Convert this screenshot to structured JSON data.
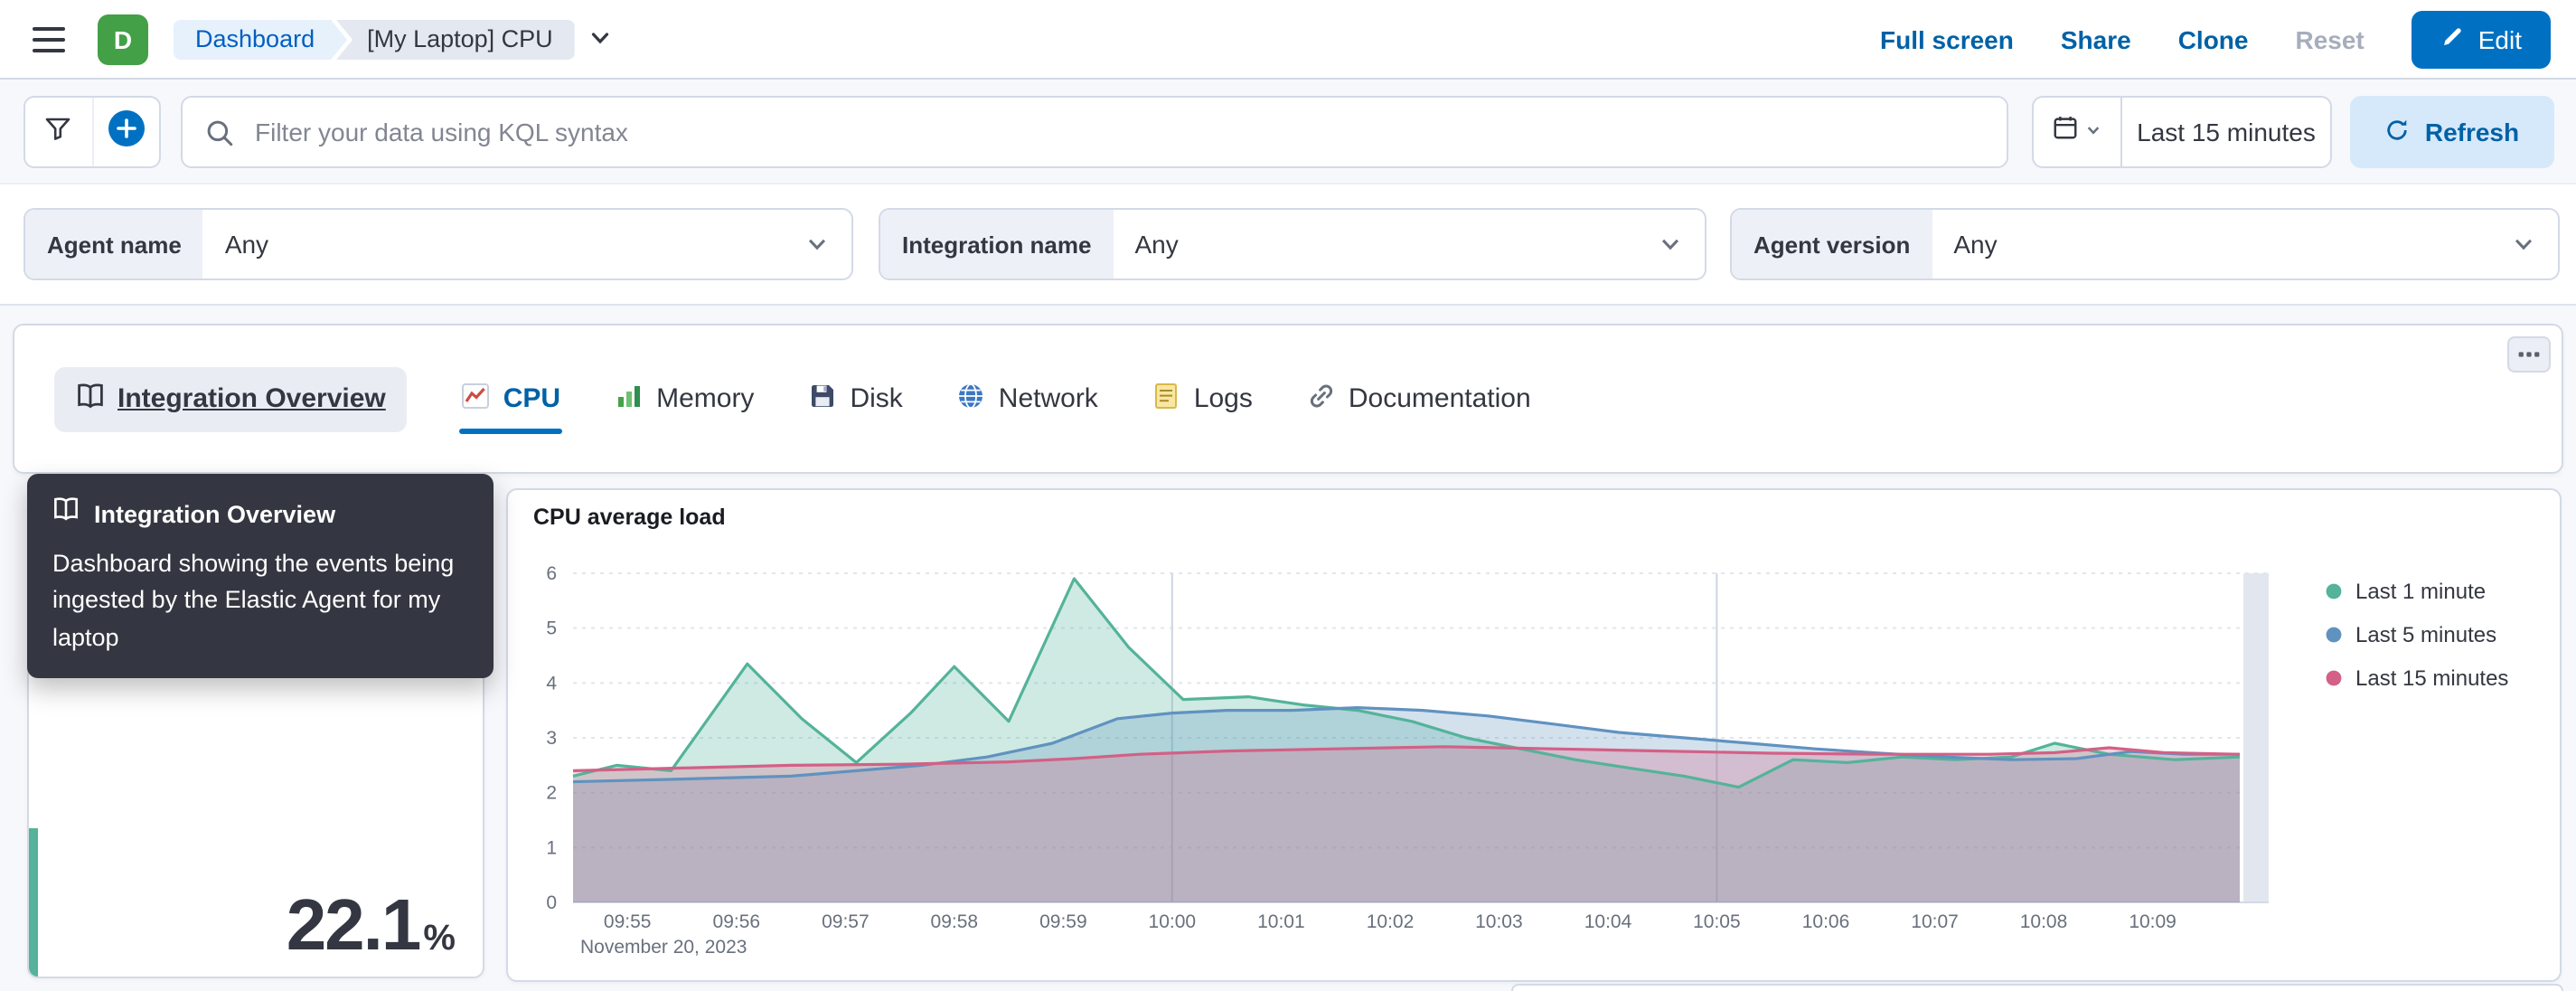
{
  "header": {
    "space_initial": "D",
    "space_color": "#43A047",
    "breadcrumbs": [
      {
        "label": "Dashboard"
      },
      {
        "label": "[My Laptop] CPU"
      }
    ],
    "actions": {
      "full_screen": "Full screen",
      "share": "Share",
      "clone": "Clone",
      "reset": "Reset",
      "edit": "Edit"
    }
  },
  "query_bar": {
    "search_placeholder": "Filter your data using KQL syntax",
    "time_range": "Last 15 minutes",
    "refresh_label": "Refresh"
  },
  "controls": [
    {
      "label": "Agent name",
      "value": "Any"
    },
    {
      "label": "Integration name",
      "value": "Any"
    },
    {
      "label": "Agent version",
      "value": "Any"
    }
  ],
  "links_panel": {
    "tabs": [
      {
        "label": "Integration Overview",
        "icon": "book-icon",
        "state": "hovered"
      },
      {
        "label": "CPU",
        "icon": "line-chart-icon",
        "state": "selected"
      },
      {
        "label": "Memory",
        "icon": "bar-chart-icon",
        "state": "default"
      },
      {
        "label": "Disk",
        "icon": "floppy-disk-icon",
        "state": "default"
      },
      {
        "label": "Network",
        "icon": "globe-icon",
        "state": "default"
      },
      {
        "label": "Logs",
        "icon": "notepad-icon",
        "state": "default"
      },
      {
        "label": "Documentation",
        "icon": "link-icon",
        "state": "default"
      }
    ]
  },
  "tooltip": {
    "title": "Integration Overview",
    "body": "Dashboard showing the events being ingested by the Elastic Agent for my laptop"
  },
  "metric_panel": {
    "value": "22.1",
    "unit": "%",
    "accent_color": "#54B399"
  },
  "chart_data": {
    "type": "area",
    "title": "CPU average load",
    "x_date_label": "November 20, 2023",
    "x_origin_time": "09:54:30",
    "x_points_unit": "minutes after x_origin_time",
    "x_ticks": [
      "09:55",
      "09:56",
      "09:57",
      "09:58",
      "09:59",
      "10:00",
      "10:01",
      "10:02",
      "10:03",
      "10:04",
      "10:05",
      "10:06",
      "10:07",
      "10:08",
      "10:09"
    ],
    "highlight_ticks": [
      "10:00",
      "10:05"
    ],
    "y_ticks": [
      0,
      1,
      2,
      3,
      4,
      5,
      6
    ],
    "ylim": [
      0,
      6
    ],
    "legend_position": "right",
    "series": [
      {
        "name": "Last 1 minute",
        "color": "#54B399",
        "points": [
          [
            0,
            2.3
          ],
          [
            0.4,
            2.5
          ],
          [
            0.9,
            2.4
          ],
          [
            1.6,
            4.35
          ],
          [
            2.1,
            3.35
          ],
          [
            2.6,
            2.55
          ],
          [
            3.1,
            3.45
          ],
          [
            3.5,
            4.3
          ],
          [
            4.0,
            3.3
          ],
          [
            4.6,
            5.9
          ],
          [
            5.1,
            4.65
          ],
          [
            5.6,
            3.7
          ],
          [
            6.2,
            3.75
          ],
          [
            6.7,
            3.6
          ],
          [
            7.2,
            3.5
          ],
          [
            7.7,
            3.3
          ],
          [
            8.2,
            3.0
          ],
          [
            8.7,
            2.8
          ],
          [
            9.2,
            2.6
          ],
          [
            9.7,
            2.45
          ],
          [
            10.2,
            2.3
          ],
          [
            10.7,
            2.1
          ],
          [
            11.2,
            2.6
          ],
          [
            11.7,
            2.55
          ],
          [
            12.2,
            2.65
          ],
          [
            12.7,
            2.6
          ],
          [
            13.2,
            2.65
          ],
          [
            13.6,
            2.9
          ],
          [
            14.1,
            2.7
          ],
          [
            14.7,
            2.6
          ],
          [
            15.3,
            2.65
          ]
        ]
      },
      {
        "name": "Last 5 minutes",
        "color": "#6092C0",
        "points": [
          [
            0,
            2.2
          ],
          [
            1,
            2.25
          ],
          [
            2,
            2.3
          ],
          [
            2.6,
            2.4
          ],
          [
            3.2,
            2.5
          ],
          [
            3.8,
            2.65
          ],
          [
            4.4,
            2.9
          ],
          [
            5.0,
            3.35
          ],
          [
            5.5,
            3.45
          ],
          [
            6.0,
            3.5
          ],
          [
            6.6,
            3.5
          ],
          [
            7.2,
            3.55
          ],
          [
            7.8,
            3.5
          ],
          [
            8.4,
            3.4
          ],
          [
            9.0,
            3.25
          ],
          [
            9.6,
            3.1
          ],
          [
            10.2,
            3.0
          ],
          [
            10.8,
            2.9
          ],
          [
            11.4,
            2.8
          ],
          [
            12.0,
            2.72
          ],
          [
            12.6,
            2.65
          ],
          [
            13.2,
            2.6
          ],
          [
            13.8,
            2.62
          ],
          [
            14.3,
            2.75
          ],
          [
            14.8,
            2.7
          ],
          [
            15.3,
            2.7
          ]
        ]
      },
      {
        "name": "Last 15 minutes",
        "color": "#D36086",
        "points": [
          [
            0,
            2.4
          ],
          [
            1,
            2.45
          ],
          [
            2,
            2.5
          ],
          [
            3,
            2.52
          ],
          [
            4,
            2.56
          ],
          [
            4.6,
            2.62
          ],
          [
            5.2,
            2.7
          ],
          [
            6,
            2.76
          ],
          [
            7,
            2.8
          ],
          [
            8,
            2.84
          ],
          [
            9,
            2.8
          ],
          [
            10,
            2.76
          ],
          [
            11,
            2.72
          ],
          [
            12,
            2.7
          ],
          [
            13,
            2.7
          ],
          [
            13.6,
            2.73
          ],
          [
            14.1,
            2.82
          ],
          [
            14.6,
            2.73
          ],
          [
            15.3,
            2.7
          ]
        ]
      }
    ]
  }
}
